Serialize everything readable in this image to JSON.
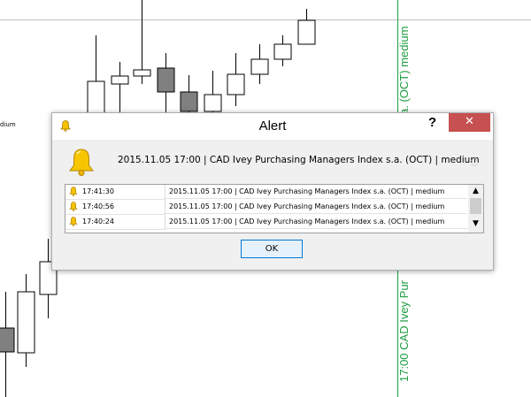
{
  "chart": {
    "edge_label": "dium",
    "event_label_top": "a. (OCT) medium",
    "event_label_bottom": "17:00 CAD Ivey Pur",
    "colors": {
      "event_line": "#1e9c40",
      "bear_candle": "#808080",
      "bull_candle": "#ffffff"
    }
  },
  "dialog": {
    "title": "Alert",
    "help_label": "?",
    "close_label": "✕",
    "message": "2015.11.05  17:00 | CAD Ivey Purchasing Managers Index s.a. (OCT) | medium",
    "history": [
      {
        "time": "17:41:30",
        "message": "2015.11.05  17:00 | CAD Ivey Purchasing Managers Index s.a. (OCT) | medium"
      },
      {
        "time": "17:40:56",
        "message": "2015.11.05  17:00 | CAD Ivey Purchasing Managers Index s.a. (OCT) | medium"
      },
      {
        "time": "17:40:24",
        "message": "2015.11.05  17:00 | CAD Ivey Purchasing Managers Index s.a. (OCT) | medium"
      }
    ],
    "ok_label": "OK",
    "icons": {
      "title": "bell-icon",
      "message": "bell-icon",
      "row": "bell-icon"
    }
  }
}
